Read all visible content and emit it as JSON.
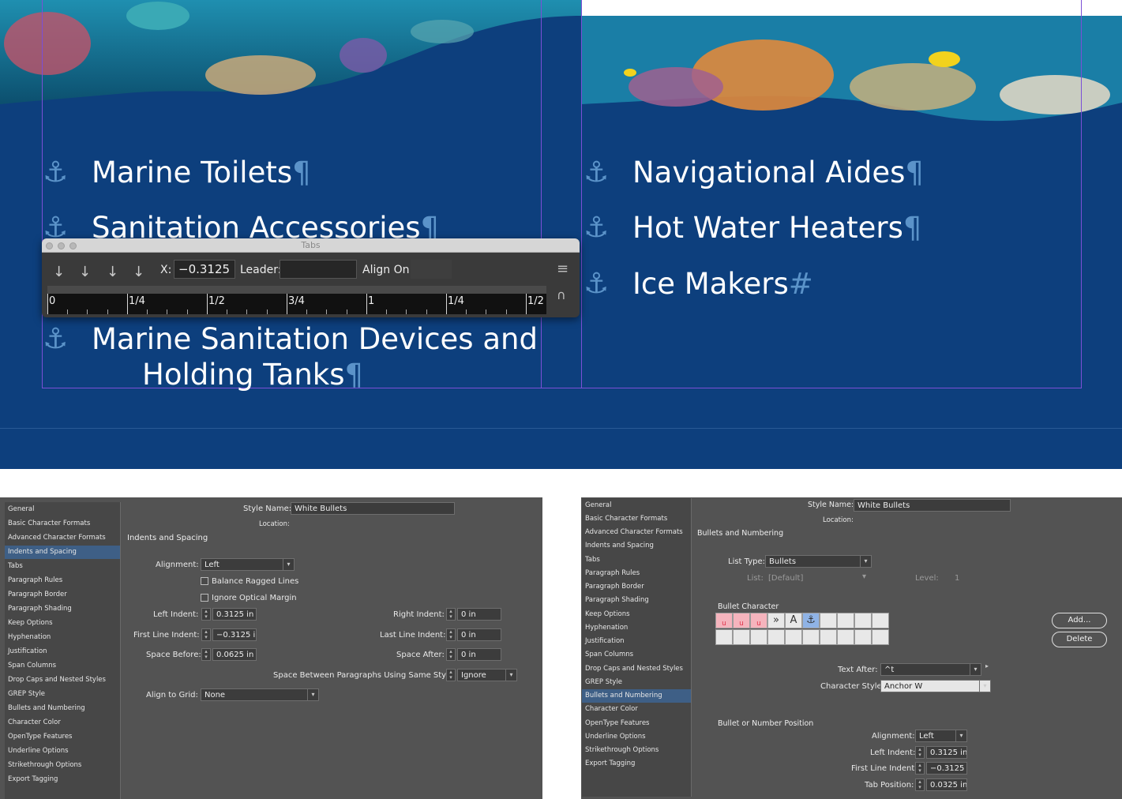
{
  "document": {
    "left_items": [
      "Marine Toilets",
      "Sanitation Accessories"
    ],
    "left_item_wrap": {
      "line1": "Marine Sanitation Devices and",
      "line2": "Holding Tanks"
    },
    "right_items": [
      "Navigational Aides",
      "Hot Water Heaters",
      "Ice Makers"
    ],
    "bullet_glyph": "⚓",
    "pilcrow": "¶",
    "end_mark": "#"
  },
  "tabs_panel": {
    "title": "Tabs",
    "x_label": "X:",
    "x_value": "−0.3125 i",
    "leader_label": "Leader:",
    "leader_value": "",
    "align_on_label": "Align On:",
    "align_on_value": "",
    "ruler_labels": [
      "0",
      "1/4",
      "1/2",
      "3/4",
      "1",
      "1/4",
      "1/2"
    ]
  },
  "dialog_left": {
    "style_name_label": "Style Name:",
    "style_name": "White Bullets",
    "location_label": "Location:",
    "section_title": "Indents and Spacing",
    "categories": [
      "General",
      "Basic Character Formats",
      "Advanced Character Formats",
      "Indents and Spacing",
      "Tabs",
      "Paragraph Rules",
      "Paragraph Border",
      "Paragraph Shading",
      "Keep Options",
      "Hyphenation",
      "Justification",
      "Span Columns",
      "Drop Caps and Nested Styles",
      "GREP Style",
      "Bullets and Numbering",
      "Character Color",
      "OpenType Features",
      "Underline Options",
      "Strikethrough Options",
      "Export Tagging"
    ],
    "alignment_label": "Alignment:",
    "alignment_value": "Left",
    "balance_label": "Balance Ragged Lines",
    "ignore_label": "Ignore Optical Margin",
    "left_indent_label": "Left Indent:",
    "left_indent": "0.3125 in",
    "first_line_label": "First Line Indent:",
    "first_line": "−0.3125 in",
    "space_before_label": "Space Before:",
    "space_before": "0.0625 in",
    "right_indent_label": "Right Indent:",
    "right_indent": "0 in",
    "last_line_label": "Last Line Indent:",
    "last_line": "0 in",
    "space_after_label": "Space After:",
    "space_after": "0 in",
    "space_between_label": "Space Between Paragraphs Using Same Style:",
    "space_between": "Ignore",
    "align_grid_label": "Align to Grid:",
    "align_grid": "None"
  },
  "dialog_right": {
    "style_name_label": "Style Name:",
    "style_name": "White Bullets",
    "location_label": "Location:",
    "section_title": "Bullets and Numbering",
    "categories": [
      "General",
      "Basic Character Formats",
      "Advanced Character Formats",
      "Indents and Spacing",
      "Tabs",
      "Paragraph Rules",
      "Paragraph Border",
      "Paragraph Shading",
      "Keep Options",
      "Hyphenation",
      "Justification",
      "Span Columns",
      "Drop Caps and Nested Styles",
      "GREP Style",
      "Bullets and Numbering",
      "Character Color",
      "OpenType Features",
      "Underline Options",
      "Strikethrough Options",
      "Export Tagging"
    ],
    "list_type_label": "List Type:",
    "list_type": "Bullets",
    "list_label": "List:",
    "list_value": "[Default]",
    "level_label": "Level:",
    "level_value": "1",
    "bullet_char_title": "Bullet Character",
    "bullet_cells": [
      "u",
      "u",
      "u",
      "»",
      "A",
      "⚓"
    ],
    "add_button": "Add...",
    "delete_button": "Delete",
    "text_after_label": "Text After:",
    "text_after": "^t",
    "char_style_label": "Character Style:",
    "char_style": "Anchor W",
    "position_title": "Bullet or Number Position",
    "alignment_label": "Alignment:",
    "alignment": "Left",
    "left_indent_label": "Left Indent:",
    "left_indent": "0.3125 in",
    "first_line_label": "First Line Indent:",
    "first_line": "−0.3125 in",
    "tab_position_label": "Tab Position:",
    "tab_position": "0.0325 in"
  }
}
